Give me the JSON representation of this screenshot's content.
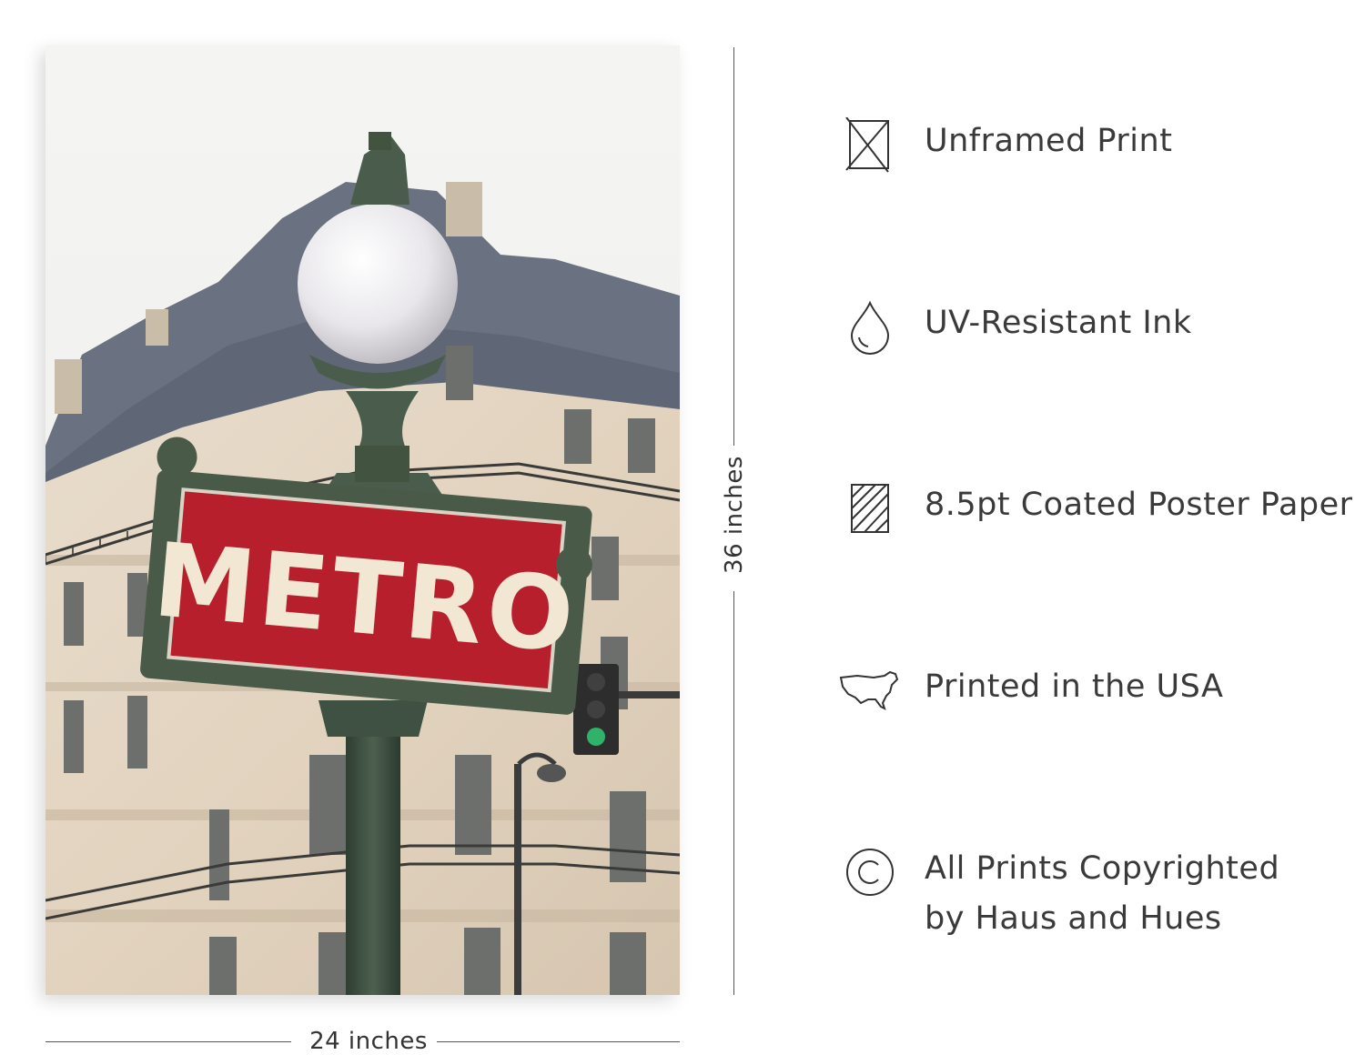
{
  "dimensions": {
    "height_label": "36 inches",
    "width_label": "24 inches"
  },
  "poster": {
    "sign_text": "METRO",
    "sign_color": "#b81f2c",
    "frame_color": "#4a5a48"
  },
  "features": [
    {
      "icon": "unframed-print-icon",
      "text": "Unframed Print"
    },
    {
      "icon": "ink-drop-icon",
      "text": "UV-Resistant Ink"
    },
    {
      "icon": "paper-icon",
      "text": "8.5pt Coated Poster Paper"
    },
    {
      "icon": "usa-map-icon",
      "text": "Printed in the USA"
    },
    {
      "icon": "copyright-icon",
      "text": "All Prints Copyrighted",
      "text2": "by Haus and Hues"
    }
  ]
}
